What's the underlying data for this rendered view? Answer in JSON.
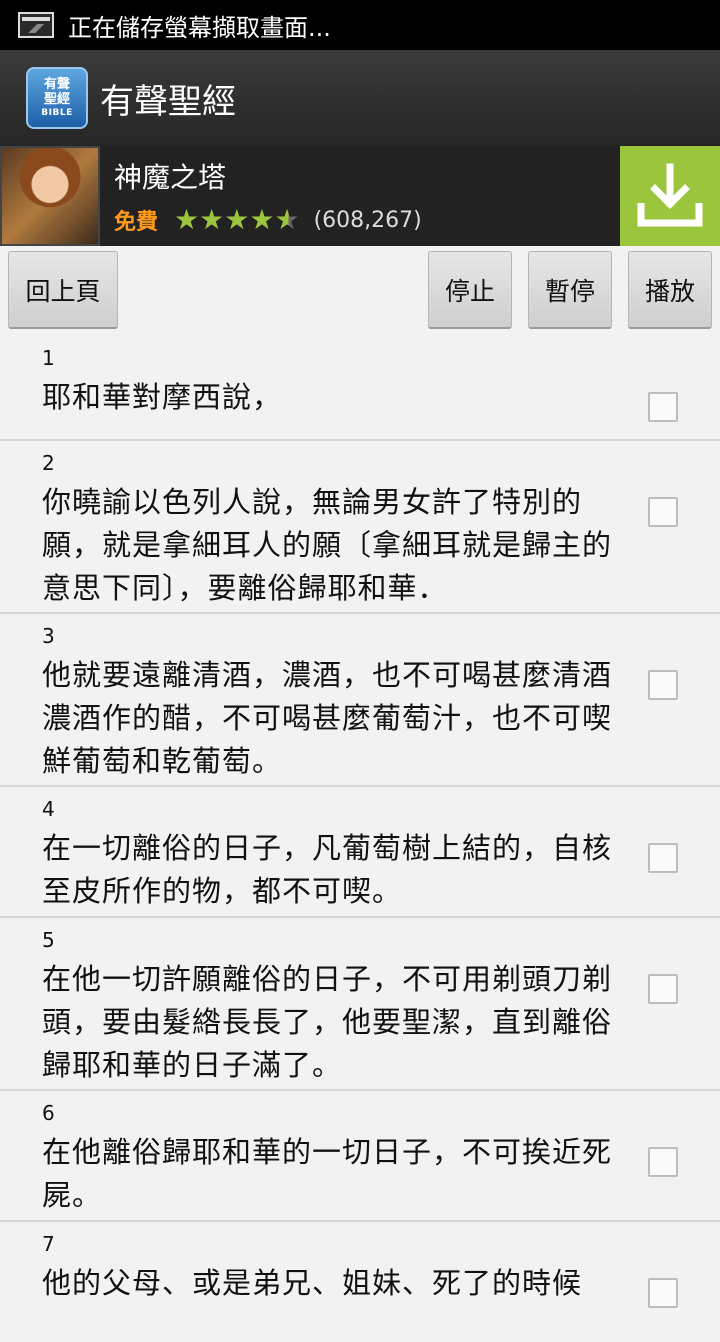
{
  "status_bar": {
    "text": "正在儲存螢幕擷取畫面..."
  },
  "action_bar": {
    "logo_line1": "有聲",
    "logo_line2": "聖經",
    "logo_line3": "BIBLE",
    "title": "有聲聖經"
  },
  "ad": {
    "title": "神魔之塔",
    "price": "免費",
    "rating": 4.5,
    "reviews": "(608,267)",
    "accent_color": "#9bc53d"
  },
  "toolbar": {
    "back_label": "回上頁",
    "stop_label": "停止",
    "pause_label": "暫停",
    "play_label": "播放"
  },
  "verses": [
    {
      "num": "1",
      "text": "耶和華對摩西說，"
    },
    {
      "num": "2",
      "text": "你曉諭以色列人說，無論男女許了特別的願，就是拿細耳人的願〔拿細耳就是歸主的意思下同〕，要離俗歸耶和華．"
    },
    {
      "num": "3",
      "text": "他就要遠離清酒，濃酒，也不可喝甚麼清酒濃酒作的醋，不可喝甚麼葡萄汁，也不可喫鮮葡萄和乾葡萄。"
    },
    {
      "num": "4",
      "text": "在一切離俗的日子，凡葡萄樹上結的，自核至皮所作的物，都不可喫。"
    },
    {
      "num": "5",
      "text": "在他一切許願離俗的日子，不可用剃頭刀剃頭，要由髮綹長長了，他要聖潔，直到離俗歸耶和華的日子滿了。"
    },
    {
      "num": "6",
      "text": "在他離俗歸耶和華的一切日子，不可挨近死屍。"
    },
    {
      "num": "7",
      "text": "他的父母、或是弟兄、姐妹、死了的時候"
    }
  ]
}
